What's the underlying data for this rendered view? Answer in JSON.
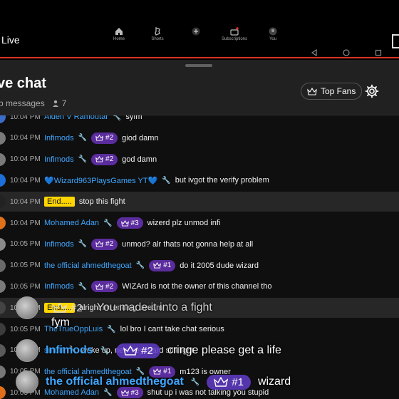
{
  "top": {
    "live_label": "Live",
    "nav": [
      {
        "label": "Home",
        "icon": "home-icon"
      },
      {
        "label": "Shorts",
        "icon": "shorts-icon"
      },
      {
        "label": "",
        "icon": "create-icon"
      },
      {
        "label": "Subscriptions",
        "icon": "subscriptions-icon"
      },
      {
        "label": "You",
        "icon": "you-icon"
      }
    ]
  },
  "header": {
    "title": "ve chat",
    "subtitle": "p messages",
    "viewer_count": "7",
    "top_fans_label": "Top Fans"
  },
  "messages": [
    {
      "time": "10:04 PM",
      "author": "Aiden V Ramoutar",
      "mod": true,
      "badge": "",
      "owner": false,
      "text": "syfm"
    },
    {
      "time": "10:04 PM",
      "author": "Infimods",
      "mod": true,
      "badge": "#2",
      "owner": false,
      "text": "giod damn"
    },
    {
      "time": "10:04 PM",
      "author": "Infimods",
      "mod": true,
      "badge": "#2",
      "owner": false,
      "text": "god damn"
    },
    {
      "time": "10:04 PM",
      "author": "💙Wizard963PlaysGames YT💙",
      "mod": true,
      "badge": "",
      "owner": false,
      "text": "but ivgot the verify problem"
    },
    {
      "time": "10:04 PM",
      "author": "End.....",
      "mod": false,
      "badge": "",
      "owner": true,
      "text": "stop this fight"
    },
    {
      "time": "10:04 PM",
      "author": "Mohamed Adan",
      "mod": true,
      "badge": "#3",
      "owner": false,
      "text": "wizerd plz unmod infi"
    },
    {
      "time": "10:05 PM",
      "author": "Infimods",
      "mod": true,
      "badge": "#2",
      "owner": false,
      "text": "unmod? alr thats not gonna help at all"
    },
    {
      "time": "10:05 PM",
      "author": "the official ahmedthegoat",
      "mod": true,
      "badge": "#1",
      "owner": false,
      "text": "do it 2005 dude wizard"
    },
    {
      "time": "10:05 PM",
      "author": "Infimods",
      "mod": true,
      "badge": "#2",
      "owner": false,
      "text": "WIZArd is not the owner of this channel tho"
    },
    {
      "time": "10:05 PM",
      "author": "End.....",
      "mod": false,
      "badge": "",
      "owner": true,
      "text": "alright im ending stream"
    },
    {
      "time": "10:05 PM",
      "author": "TheTrueOppLuis",
      "mod": true,
      "badge": "",
      "owner": false,
      "text": "lol bro I cant take chat serious"
    },
    {
      "time": "10:05 PM",
      "author": "smurf",
      "mod": true,
      "badge": "",
      "owner": false,
      "text": "woke up, new keyboard still light"
    },
    {
      "time": "10:05 PM",
      "author": "the official ahmedthegoat",
      "mod": true,
      "badge": "#1",
      "owner": false,
      "text": "m123 is owner"
    },
    {
      "time": "10:05 PM",
      "author": "Mohamed Adan",
      "mod": true,
      "badge": "#3",
      "owner": false,
      "text": "shut up i was not talking you stupid"
    }
  ],
  "overlay": [
    {
      "author": "",
      "badge": "#2",
      "text": "You made it into a fight",
      "faded": true
    },
    {
      "author": "",
      "badge": "",
      "text": "fym",
      "faded": false
    },
    {
      "author": "Infimods",
      "badge": "#2",
      "text": "cringe please get a life",
      "faded": false
    },
    {
      "author": "the official ahmedthegoat",
      "badge": "#1",
      "text": "wizard",
      "faded": false
    }
  ],
  "colors": {
    "accent_blue": "#3ea6ff",
    "badge_purple": "#5b2c9e",
    "owner_yellow": "#ffd600",
    "live_red": "#d93025"
  }
}
